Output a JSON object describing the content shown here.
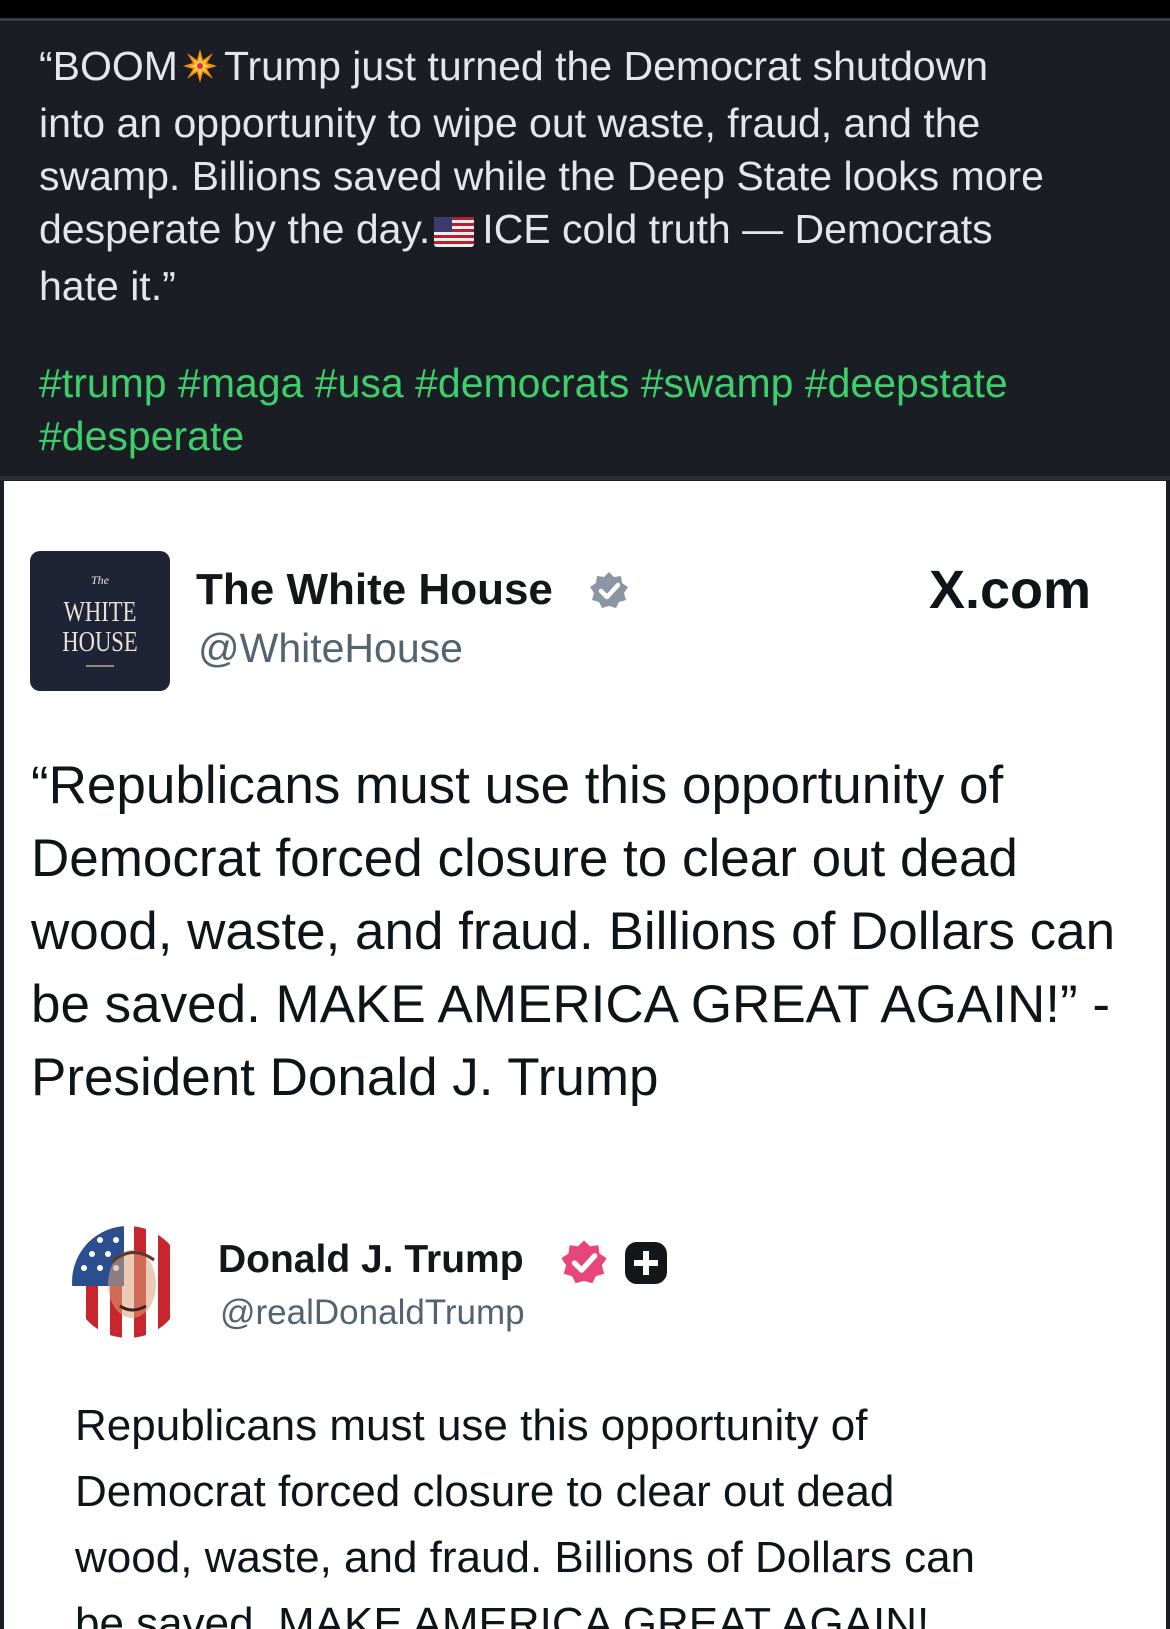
{
  "post": {
    "text_lines": [
      "“BOOM",
      "Trump just turned the Democrat shutdown",
      "into an opportunity to wipe out waste, fraud, and the",
      "swamp. Billions saved while the Deep State looks more",
      "desperate by the day.",
      "ICE cold truth — Democrats",
      "hate it.”"
    ],
    "hashtags": [
      "#trump",
      "#maga",
      "#usa",
      "#democrats",
      "#swamp",
      "#deepstate",
      "#desperate"
    ],
    "hashtag_color": "#3ecf6b",
    "emojis": [
      "collision-emoji",
      "us-flag-emoji"
    ]
  },
  "card": {
    "source": "X.com",
    "account": {
      "name": "The White House",
      "handle": "@WhiteHouse",
      "logo_the": "The",
      "logo_line1": "WHITE",
      "logo_line2": "HOUSE",
      "verified": "grey-verified-badge"
    },
    "quote_lines": [
      "“Republicans must use this opportunity of",
      "Democrat forced closure to clear out dead",
      "wood, waste, and fraud. Billions of Dollars can",
      "be saved. MAKE AMERICA GREAT AGAIN!” -",
      "President Donald J. Trump"
    ],
    "embedded": {
      "name": "Donald J. Trump",
      "handle": "@realDonaldTrump",
      "verified": "pink-verified-badge",
      "badge_color": "#e8457a",
      "body_lines": [
        "Republicans must use this opportunity of",
        "Democrat forced closure to clear out dead",
        "wood, waste, and fraud. Billions of Dollars can",
        "be saved. MAKE AMERICA GREAT AGAIN!"
      ]
    }
  }
}
